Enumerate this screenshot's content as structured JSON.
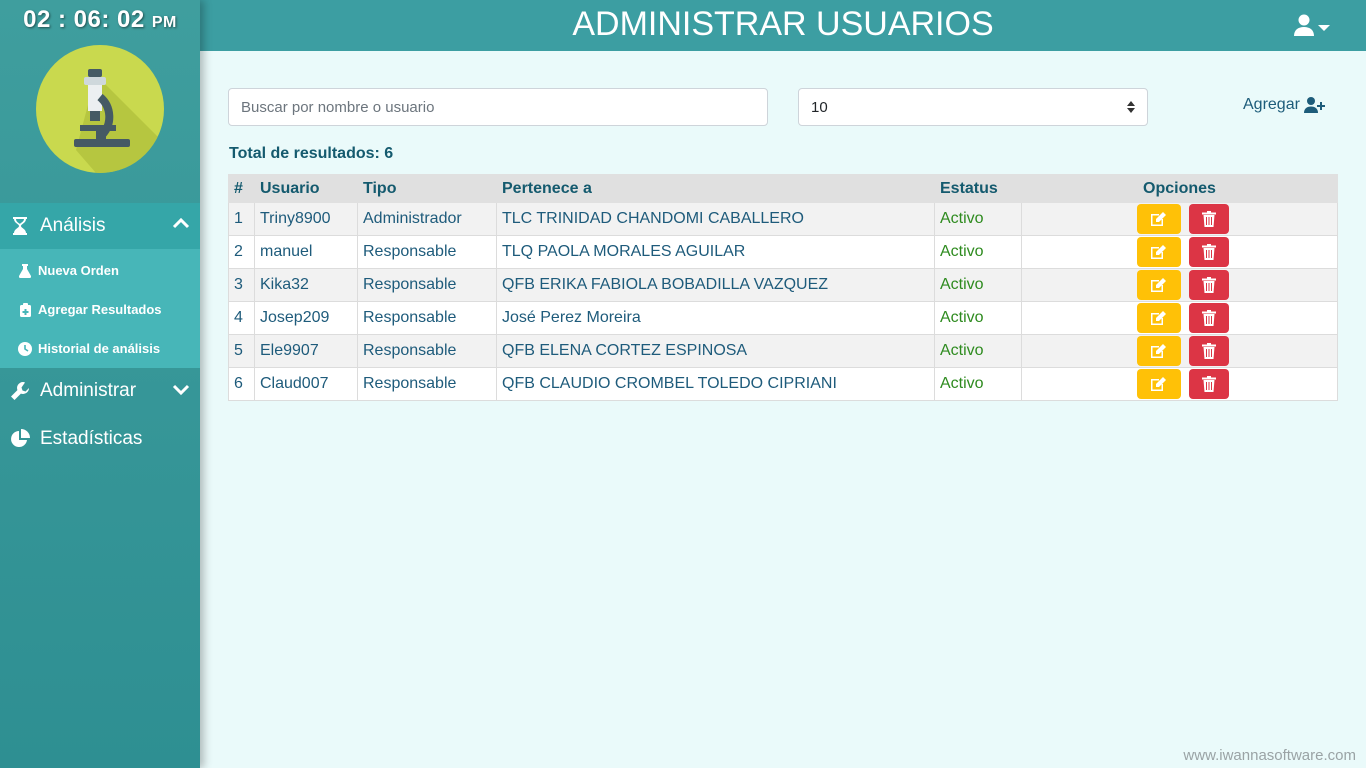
{
  "clock": {
    "time": "02 : 06: 02",
    "ampm": "PM"
  },
  "header": {
    "title": "ADMINISTRAR USUARIOS"
  },
  "sidebar": {
    "analisis": "Análisis",
    "submenu": [
      "Nueva Orden",
      "Agregar Resultados",
      "Historial de análisis"
    ],
    "administrar": "Administrar",
    "estadisticas": "Estadísticas"
  },
  "search": {
    "placeholder": "Buscar por nombre o usuario",
    "value": ""
  },
  "page_size": {
    "selected": "10"
  },
  "add": {
    "label": "Agregar"
  },
  "total": {
    "label": "Total de resultados: 6"
  },
  "table": {
    "headers": [
      "#",
      "Usuario",
      "Tipo",
      "Pertenece a",
      "Estatus",
      "Opciones"
    ],
    "rows": [
      [
        "1",
        "Triny8900",
        "Administrador",
        "TLC TRINIDAD CHANDOMI CABALLERO",
        "Activo"
      ],
      [
        "2",
        "manuel",
        "Responsable",
        "TLQ PAOLA MORALES AGUILAR",
        "Activo"
      ],
      [
        "3",
        "Kika32",
        "Responsable",
        "QFB ERIKA FABIOLA BOBADILLA VAZQUEZ",
        "Activo"
      ],
      [
        "4",
        "Josep209",
        "Responsable",
        "José Perez Moreira",
        "Activo"
      ],
      [
        "5",
        "Ele9907",
        "Responsable",
        "QFB ELENA CORTEZ ESPINOSA",
        "Activo"
      ],
      [
        "6",
        "Claud007",
        "Responsable",
        "QFB CLAUDIO CROMBEL TOLEDO CIPRIANI",
        "Activo"
      ]
    ]
  },
  "watermark": "www.iwannasoftware.com",
  "colors": {
    "sidebar": "#3f9e9e",
    "header": "#3c9ea2",
    "edit": "#ffc107",
    "delete": "#dc3545",
    "status_active": "#2e8b1f"
  },
  "icons": {
    "logo": "microscope-icon",
    "analisis": "hourglass-icon",
    "nueva_orden": "flask-icon",
    "agregar_resultados": "file-medical-icon",
    "historial": "clock-icon",
    "administrar": "wrench-icon",
    "estadisticas": "pie-chart-icon",
    "user": "user-icon",
    "add": "user-plus-icon",
    "edit": "edit-icon",
    "delete": "trash-icon"
  }
}
